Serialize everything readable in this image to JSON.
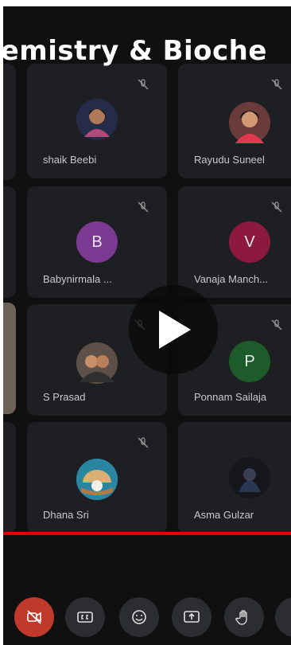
{
  "title": "hemistry & Bioche",
  "video": {
    "progress": 1.0
  },
  "participants": [
    {
      "name": "shaik Beebi",
      "avatar_type": "photo",
      "muted": true
    },
    {
      "name": "Rayudu Suneel",
      "avatar_type": "photo",
      "muted": true
    },
    {
      "name": "Babynirmala ...",
      "initial": "B",
      "avatar_color": "#7b3a92",
      "muted": true
    },
    {
      "name": "Vanaja Manch...",
      "initial": "V",
      "avatar_color": "#8c1a3e",
      "muted": true
    },
    {
      "name": "S Prasad",
      "avatar_type": "photo",
      "muted": true
    },
    {
      "name": "Ponnam Sailaja",
      "initial": "P",
      "avatar_color": "#1e5b2b",
      "muted": true
    },
    {
      "name": "Dhana Sri",
      "avatar_type": "photo",
      "muted": true
    },
    {
      "name": "Asma Gulzar",
      "avatar_type": "photo",
      "muted": true
    }
  ],
  "controls": [
    {
      "icon": "camera-off-icon",
      "color": "#c0392b"
    },
    {
      "icon": "closed-captions-icon"
    },
    {
      "icon": "emoji-icon"
    },
    {
      "icon": "present-screen-icon"
    },
    {
      "icon": "raise-hand-icon"
    },
    {
      "icon": "more-options-icon"
    }
  ]
}
